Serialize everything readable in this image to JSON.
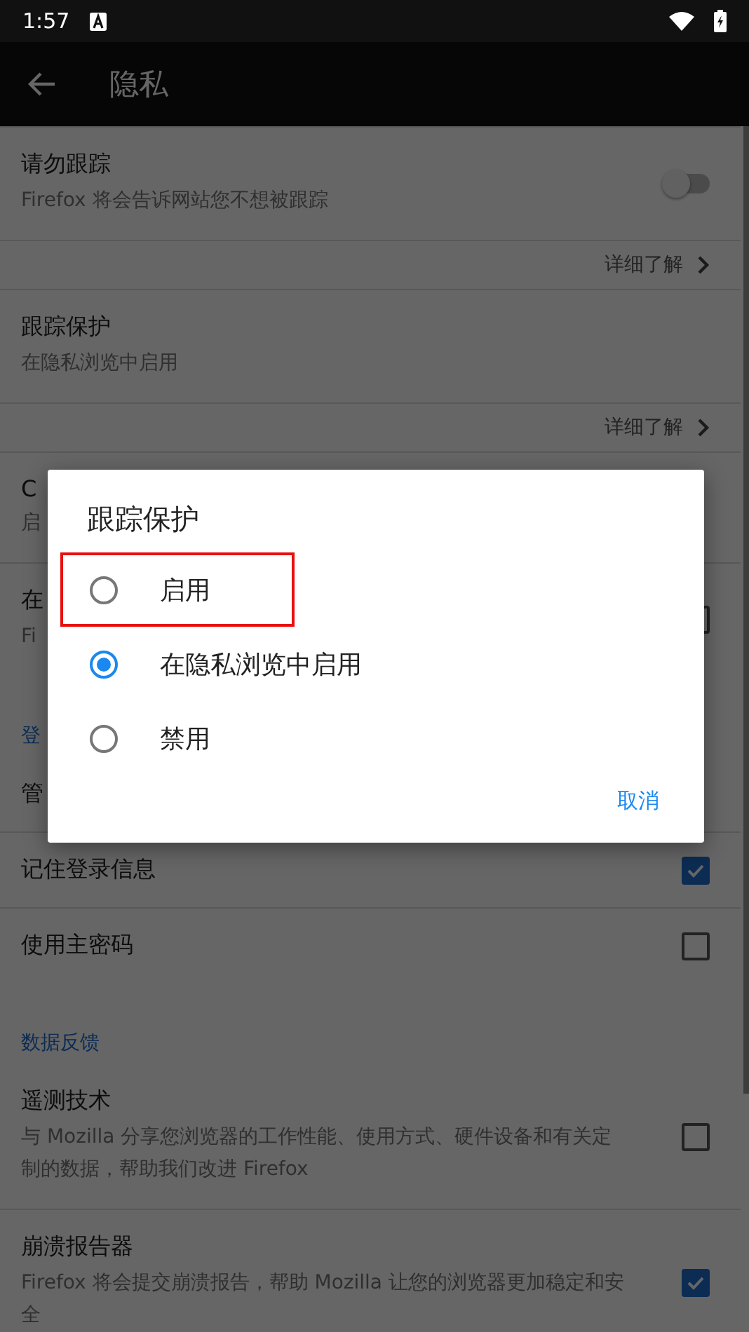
{
  "status_bar": {
    "time": "1:57"
  },
  "app_bar": {
    "title": "隐私"
  },
  "settings": [
    {
      "kind": "toggle",
      "title": "请勿跟踪",
      "subtitle": "Firefox 将会告诉网站您不想被跟踪",
      "on": false
    },
    {
      "kind": "link",
      "title": "详细了解"
    },
    {
      "kind": "text",
      "title": "跟踪保护",
      "subtitle": "在隐私浏览中启用"
    },
    {
      "kind": "link",
      "title": "详细了解"
    },
    {
      "kind": "text",
      "title": "C",
      "subtitle": "启"
    },
    {
      "kind": "checkbox",
      "title": "在",
      "subtitle": "Fi",
      "checked": false
    },
    {
      "kind": "header",
      "title": "登"
    },
    {
      "kind": "text",
      "title": "管"
    },
    {
      "kind": "checkbox",
      "title": "记住登录信息",
      "checked": true
    },
    {
      "kind": "checkbox",
      "title": "使用主密码",
      "checked": false
    },
    {
      "kind": "header",
      "title": "数据反馈"
    },
    {
      "kind": "checkbox",
      "title": "遥测技术",
      "subtitle": "与 Mozilla 分享您浏览器的工作性能、使用方式、硬件设备和有关定制的数据，帮助我们改进 Firefox",
      "checked": false
    },
    {
      "kind": "checkbox",
      "title": "崩溃报告器",
      "subtitle": "Firefox 将会提交崩溃报告，帮助 Mozilla 让您的浏览器更加稳定和安全",
      "checked": true
    }
  ],
  "dialog": {
    "title": "跟踪保护",
    "options": [
      {
        "label": "启用",
        "selected": false,
        "highlighted": true
      },
      {
        "label": "在隐私浏览中启用",
        "selected": true,
        "highlighted": false
      },
      {
        "label": "禁用",
        "selected": false,
        "highlighted": false
      }
    ],
    "buttons": [
      "取消"
    ]
  }
}
